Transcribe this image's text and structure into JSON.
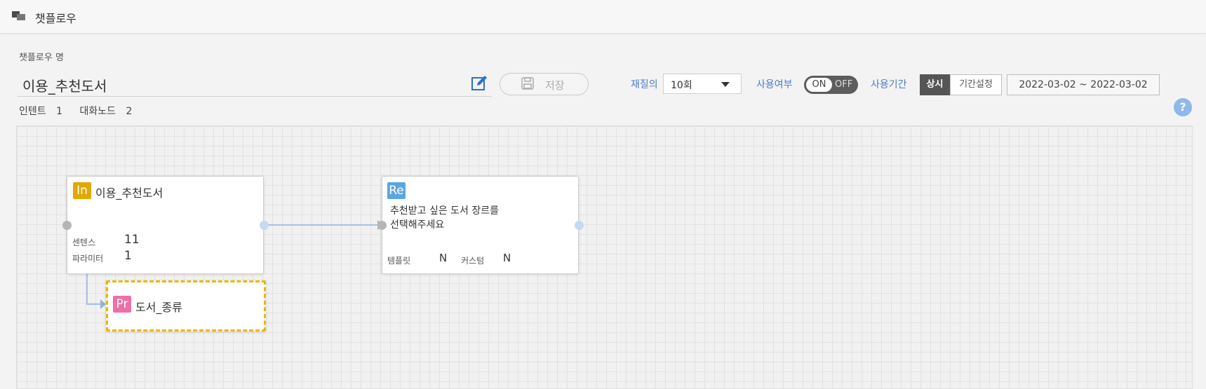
{
  "app": {
    "title": "챗플로우"
  },
  "form": {
    "name_label": "챗플로우 명",
    "name_value": "이용_추천도서",
    "save_label": "저장",
    "retry_label": "재질의",
    "retry_value": "10회",
    "use_label": "사용여부",
    "toggle_on": "ON",
    "toggle_off": "OFF",
    "period_label": "사용기간",
    "period_always": "상시",
    "period_set": "기간설정",
    "date_range": "2022-03-02 ~ 2022-03-02",
    "help": "?"
  },
  "stats": {
    "intent_label": "인텐트",
    "intent_count": "1",
    "node_label": "대화노드",
    "node_count": "2"
  },
  "nodes": {
    "intent": {
      "badge": "In",
      "title": "이용_추천도서",
      "k1": "센텐스",
      "v1": "11",
      "k2": "파라미터",
      "v2": "1"
    },
    "response": {
      "badge": "Re",
      "line1": "추천받고 싶은 도서 장르를",
      "line2": "선택해주세요",
      "k1": "템플릿",
      "v1": "N",
      "k2": "커스텀",
      "v2": "N"
    },
    "param": {
      "badge": "Pr",
      "title": "도서_종류"
    }
  },
  "colors": {
    "intent_badge": "#e0a800",
    "response_badge": "#5aa6e0",
    "param_badge": "#ee6fa8",
    "param_border": "#f0b400",
    "link": "#8fb3e0"
  }
}
